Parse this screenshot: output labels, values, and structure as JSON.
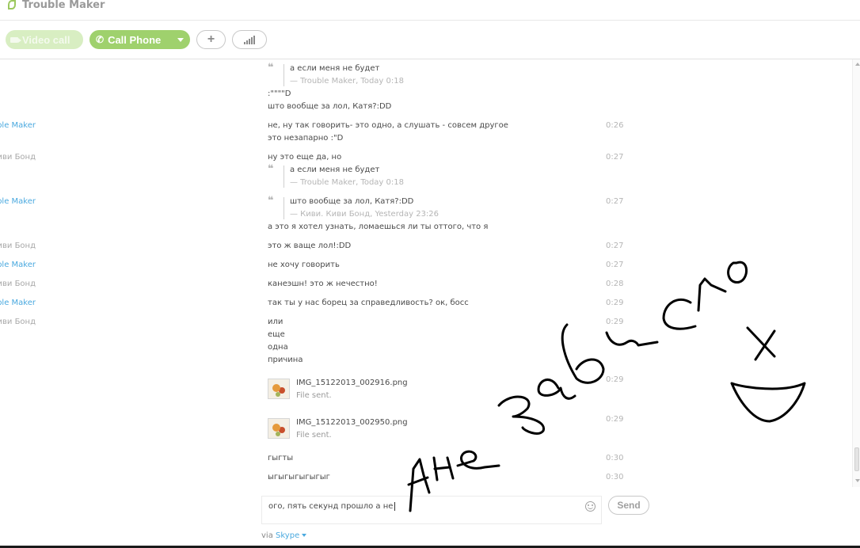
{
  "window": {
    "title": "Trouble Maker"
  },
  "toolbar": {
    "video_label": "Video call",
    "call_label": "Call Phone",
    "add_label": "+"
  },
  "messages": [
    {
      "sender": "",
      "time": "",
      "quote": {
        "text": "а если меня не будет",
        "meta": "— Trouble Maker, Today 0:18"
      },
      "lines": [
        ":\"\"\"\"D",
        "што вообще за лол, Катя?:DD"
      ]
    },
    {
      "sender": "Trouble Maker",
      "time": "0:26",
      "lines": [
        "не, ну так говорить- это одно, а слушать - совсем другое",
        "это незапарно :\"D"
      ]
    },
    {
      "sender": "Киви. Киви Бонд",
      "time": "0:27",
      "lines": [
        "ну это еще да, но"
      ],
      "quote": {
        "text": "а если меня не будет",
        "meta": "— Trouble Maker, Today 0:18"
      }
    },
    {
      "sender": "Trouble Maker",
      "time": "0:27",
      "quote": {
        "text": "што вообще за лол, Катя?:DD",
        "meta": "— Киви. Киви Бонд, Yesterday 23:26"
      },
      "lines": [
        "а это я хотел узнать, ломаешься ли ты оттого, что я"
      ]
    },
    {
      "sender": "Киви. Киви Бонд",
      "time": "0:27",
      "lines": [
        "это ж ваще лол!:DD"
      ]
    },
    {
      "sender": "Trouble Maker",
      "time": "0:27",
      "lines": [
        "не хочу говорить"
      ]
    },
    {
      "sender": "Киви. Киви Бонд",
      "time": "0:28",
      "lines": [
        "канеэшн! это ж нечестно!"
      ]
    },
    {
      "sender": "Trouble Maker",
      "time": "0:29",
      "lines": [
        "так ты у нас борец за справедливость? ок, босс"
      ]
    },
    {
      "sender": "Киви. Киви Бонд",
      "time": "0:29",
      "lines": [
        "или",
        "еще",
        "одна",
        "причина"
      ]
    },
    {
      "time": "0:29",
      "file": {
        "name": "IMG_15122013_002916.png",
        "status": "File sent."
      }
    },
    {
      "time": "0:29",
      "file": {
        "name": "IMG_15122013_002950.png",
        "status": "File sent."
      }
    },
    {
      "time": "0:30",
      "lines": [
        "гыгты"
      ]
    },
    {
      "time": "0:30",
      "lines": [
        "ыгыгыгыгыгыг"
      ]
    }
  ],
  "composer": {
    "value": "ого, пять секунд прошло а не",
    "send_label": "Send",
    "via_prefix": "via",
    "via_link": "Skype"
  },
  "handwriting": {
    "text": "А не зависло",
    "x_mark": "x"
  },
  "colors": {
    "accent_green": "#9fd16d",
    "link_blue": "#4aa9df",
    "ink": "#000000"
  }
}
